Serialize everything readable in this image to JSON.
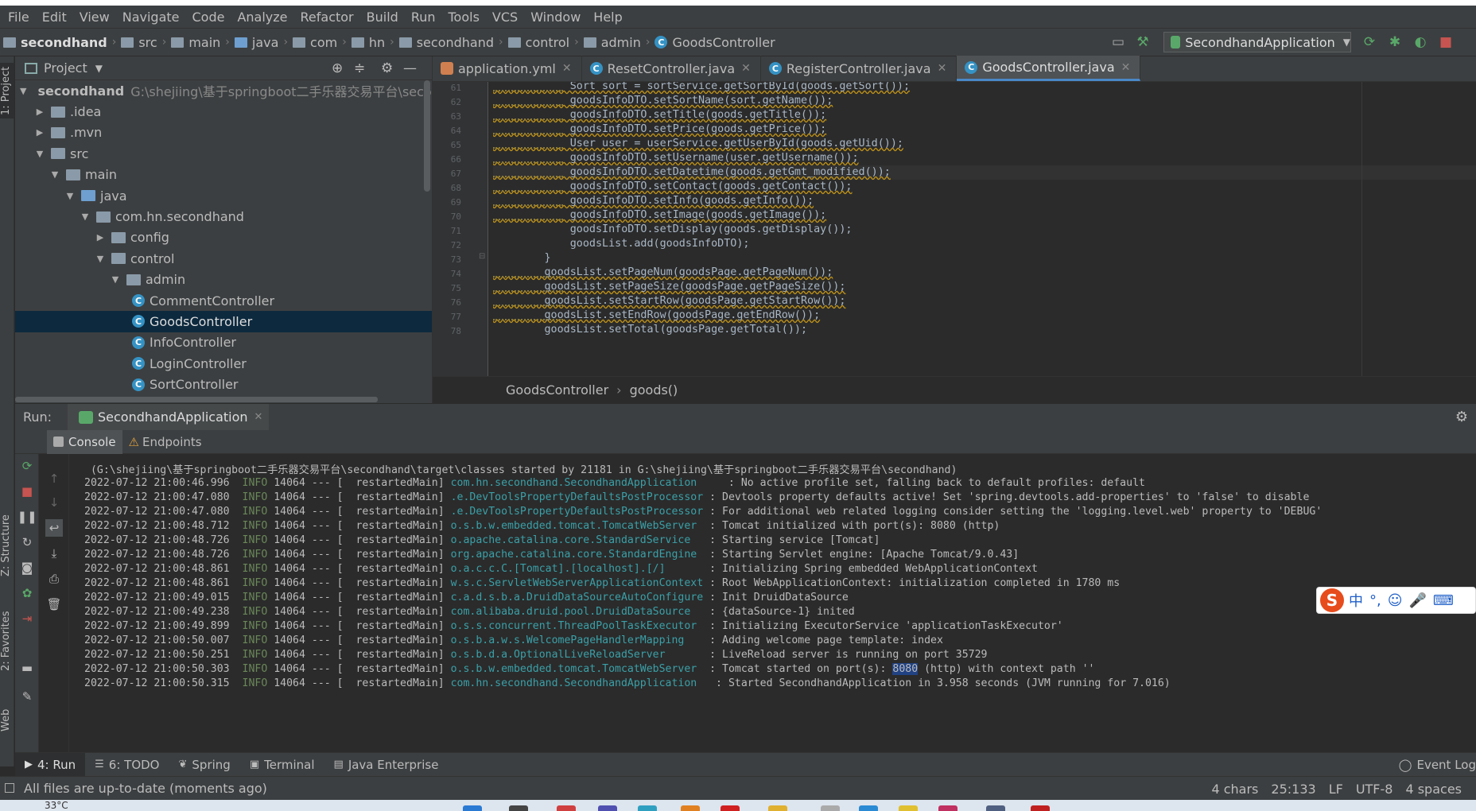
{
  "menu": [
    "File",
    "Edit",
    "View",
    "Navigate",
    "Code",
    "Analyze",
    "Refactor",
    "Build",
    "Run",
    "Tools",
    "VCS",
    "Window",
    "Help"
  ],
  "breadcrumb": [
    "secondhand",
    "src",
    "main",
    "java",
    "com",
    "hn",
    "secondhand",
    "control",
    "admin",
    "GoodsController"
  ],
  "run_config": "SecondhandApplication",
  "left_stripe": {
    "project": "1: Project",
    "structure": "Z: Structure",
    "favorites": "2: Favorites",
    "web": "Web"
  },
  "project_panel": {
    "title": "Project",
    "tree": [
      {
        "label": "secondhand",
        "path": "G:\\shejiing\\基于springboot二手乐器交易平台\\secondhand",
        "level": 0,
        "arrow": "down",
        "icon": "folder"
      },
      {
        "label": ".idea",
        "level": 1,
        "arrow": "right",
        "icon": "folder"
      },
      {
        "label": ".mvn",
        "level": 1,
        "arrow": "right",
        "icon": "folder"
      },
      {
        "label": "src",
        "level": 1,
        "arrow": "down",
        "icon": "folder"
      },
      {
        "label": "main",
        "level": 2,
        "arrow": "down",
        "icon": "folder"
      },
      {
        "label": "java",
        "level": 3,
        "arrow": "down",
        "icon": "folder-blue"
      },
      {
        "label": "com.hn.secondhand",
        "level": 4,
        "arrow": "down",
        "icon": "package"
      },
      {
        "label": "config",
        "level": 5,
        "arrow": "right",
        "icon": "package"
      },
      {
        "label": "control",
        "level": 5,
        "arrow": "down",
        "icon": "package"
      },
      {
        "label": "admin",
        "level": 6,
        "arrow": "down",
        "icon": "package"
      },
      {
        "label": "CommentController",
        "level": 7,
        "arrow": "",
        "icon": "class"
      },
      {
        "label": "GoodsController",
        "level": 7,
        "arrow": "",
        "icon": "class",
        "selected": true
      },
      {
        "label": "InfoController",
        "level": 7,
        "arrow": "",
        "icon": "class"
      },
      {
        "label": "LoginController",
        "level": 7,
        "arrow": "",
        "icon": "class"
      },
      {
        "label": "SortController",
        "level": 7,
        "arrow": "",
        "icon": "class"
      }
    ]
  },
  "editor_tabs": [
    {
      "label": "application.yml",
      "icon": "yml"
    },
    {
      "label": "ResetController.java",
      "icon": "class"
    },
    {
      "label": "RegisterController.java",
      "icon": "class"
    },
    {
      "label": "GoodsController.java",
      "icon": "class",
      "active": true
    }
  ],
  "code": [
    {
      "ln": "61",
      "text": "            Sort sort = sortService.getSortById(goods.getSort());",
      "warn": true
    },
    {
      "ln": "62",
      "text": "            goodsInfoDTO.setSortName(sort.getName());",
      "warn": true
    },
    {
      "ln": "63",
      "text": "            goodsInfoDTO.setTitle(goods.getTitle());",
      "warn": true
    },
    {
      "ln": "64",
      "text": "            goodsInfoDTO.setPrice(goods.getPrice());",
      "warn": true
    },
    {
      "ln": "65",
      "text": "            User user = userService.getUserById(goods.getUid());",
      "warn": true
    },
    {
      "ln": "66",
      "text": "            goodsInfoDTO.setUsername(user.getUsername());",
      "warn": true
    },
    {
      "ln": "67",
      "text": "            goodsInfoDTO.setDatetime(goods.getGmt_modified());",
      "warn": true,
      "current": true
    },
    {
      "ln": "68",
      "text": "            goodsInfoDTO.setContact(goods.getContact());",
      "warn": true
    },
    {
      "ln": "69",
      "text": "            goodsInfoDTO.setInfo(goods.getInfo());",
      "warn": true
    },
    {
      "ln": "70",
      "text": "            goodsInfoDTO.setImage(goods.getImage());",
      "warn": true
    },
    {
      "ln": "71",
      "text": "            goodsInfoDTO.setDisplay(goods.getDisplay());",
      "warn": false
    },
    {
      "ln": "72",
      "text": "            goodsList.add(goodsInfoDTO);",
      "warn": false
    },
    {
      "ln": "73",
      "text": "        }",
      "warn": false
    },
    {
      "ln": "74",
      "text": "        goodsList.setPageNum(goodsPage.getPageNum());",
      "warn": true
    },
    {
      "ln": "75",
      "text": "        goodsList.setPageSize(goodsPage.getPageSize());",
      "warn": true
    },
    {
      "ln": "76",
      "text": "        goodsList.setStartRow(goodsPage.getStartRow());",
      "warn": true
    },
    {
      "ln": "77",
      "text": "        goodsList.setEndRow(goodsPage.getEndRow());",
      "warn": true
    },
    {
      "ln": "78",
      "text": "        goodsList.setTotal(goodsPage.getTotal());",
      "warn": false
    }
  ],
  "editor_breadcrumb": {
    "cls": "GoodsController",
    "method": "goods()"
  },
  "run_panel": {
    "label": "Run:",
    "tab": "SecondhandApplication"
  },
  "console_tabs": [
    "Console",
    "Endpoints"
  ],
  "console_first": " (G:\\shejiing\\基于springboot二手乐器交易平台\\secondhand\\target\\classes started by 21181 in G:\\shejiing\\基于springboot二手乐器交易平台\\secondhand)",
  "console": [
    {
      "ts": "2022-07-12 21:00:46.996",
      "lvl": "INFO",
      "pid": "14064",
      "thread": "restartedMain",
      "logger": "com.hn.secondhand.SecondhandApplication    ",
      "msg": "No active profile set, falling back to default profiles: default"
    },
    {
      "ts": "2022-07-12 21:00:47.080",
      "lvl": "INFO",
      "pid": "14064",
      "thread": "restartedMain",
      "logger": ".e.DevToolsPropertyDefaultsPostProcessor",
      "msg": "Devtools property defaults active! Set 'spring.devtools.add-properties' to 'false' to disable"
    },
    {
      "ts": "2022-07-12 21:00:47.080",
      "lvl": "INFO",
      "pid": "14064",
      "thread": "restartedMain",
      "logger": ".e.DevToolsPropertyDefaultsPostProcessor",
      "msg": "For additional web related logging consider setting the 'logging.level.web' property to 'DEBUG'"
    },
    {
      "ts": "2022-07-12 21:00:48.712",
      "lvl": "INFO",
      "pid": "14064",
      "thread": "restartedMain",
      "logger": "o.s.b.w.embedded.tomcat.TomcatWebServer ",
      "msg": "Tomcat initialized with port(s): 8080 (http)"
    },
    {
      "ts": "2022-07-12 21:00:48.726",
      "lvl": "INFO",
      "pid": "14064",
      "thread": "restartedMain",
      "logger": "o.apache.catalina.core.StandardService  ",
      "msg": "Starting service [Tomcat]"
    },
    {
      "ts": "2022-07-12 21:00:48.726",
      "lvl": "INFO",
      "pid": "14064",
      "thread": "restartedMain",
      "logger": "org.apache.catalina.core.StandardEngine ",
      "msg": "Starting Servlet engine: [Apache Tomcat/9.0.43]"
    },
    {
      "ts": "2022-07-12 21:00:48.861",
      "lvl": "INFO",
      "pid": "14064",
      "thread": "restartedMain",
      "logger": "o.a.c.c.C.[Tomcat].[localhost].[/]      ",
      "msg": "Initializing Spring embedded WebApplicationContext"
    },
    {
      "ts": "2022-07-12 21:00:48.861",
      "lvl": "INFO",
      "pid": "14064",
      "thread": "restartedMain",
      "logger": "w.s.c.ServletWebServerApplicationContext",
      "msg": "Root WebApplicationContext: initialization completed in 1780 ms"
    },
    {
      "ts": "2022-07-12 21:00:49.015",
      "lvl": "INFO",
      "pid": "14064",
      "thread": "restartedMain",
      "logger": "c.a.d.s.b.a.DruidDataSourceAutoConfigure",
      "msg": "Init DruidDataSource"
    },
    {
      "ts": "2022-07-12 21:00:49.238",
      "lvl": "INFO",
      "pid": "14064",
      "thread": "restartedMain",
      "logger": "com.alibaba.druid.pool.DruidDataSource  ",
      "msg": "{dataSource-1} inited"
    },
    {
      "ts": "2022-07-12 21:00:49.899",
      "lvl": "INFO",
      "pid": "14064",
      "thread": "restartedMain",
      "logger": "o.s.s.concurrent.ThreadPoolTaskExecutor ",
      "msg": "Initializing ExecutorService 'applicationTaskExecutor'"
    },
    {
      "ts": "2022-07-12 21:00:50.007",
      "lvl": "INFO",
      "pid": "14064",
      "thread": "restartedMain",
      "logger": "o.s.b.a.w.s.WelcomePageHandlerMapping   ",
      "msg": "Adding welcome page template: index"
    },
    {
      "ts": "2022-07-12 21:00:50.251",
      "lvl": "INFO",
      "pid": "14064",
      "thread": "restartedMain",
      "logger": "o.s.b.d.a.OptionalLiveReloadServer      ",
      "msg": "LiveReload server is running on port 35729"
    },
    {
      "ts": "2022-07-12 21:00:50.303",
      "lvl": "INFO",
      "pid": "14064",
      "thread": "restartedMain",
      "logger": "o.s.b.w.embedded.tomcat.TomcatWebServer ",
      "msg": "Tomcat started on port(s): 8080 (http) with context path ''",
      "highlight": "8080"
    },
    {
      "ts": "2022-07-12 21:00:50.315",
      "lvl": "INFO",
      "pid": "14064",
      "thread": "restartedMain",
      "logger": "com.hn.secondhand.SecondhandApplication  ",
      "msg": "Started SecondhandApplication in 3.958 seconds (JVM running for 7.016)"
    }
  ],
  "bottom_tabs": [
    {
      "label": "4: Run",
      "icon": "▶"
    },
    {
      "label": "6: TODO",
      "icon": "☰"
    },
    {
      "label": "Spring",
      "icon": "❦"
    },
    {
      "label": "Terminal",
      "icon": "▣"
    },
    {
      "label": "Java Enterprise",
      "icon": "▤"
    }
  ],
  "event_log": "Event Log",
  "status": {
    "message": "All files are up-to-date (moments ago)",
    "chars": "4 chars",
    "position": "25:133",
    "line_sep": "LF",
    "encoding": "UTF-8",
    "indent": "4 spaces"
  },
  "ime": {
    "chars": [
      "中",
      "°,",
      "☺",
      "🎤",
      "⌨"
    ]
  },
  "taskbar": {
    "weather": "33°C"
  },
  "colors": {
    "accent": "#4a88c7",
    "selected_row": "#0d293e",
    "info_green": "#6a8759",
    "logger_teal": "#3aa0a8",
    "warning": "#be9117"
  }
}
